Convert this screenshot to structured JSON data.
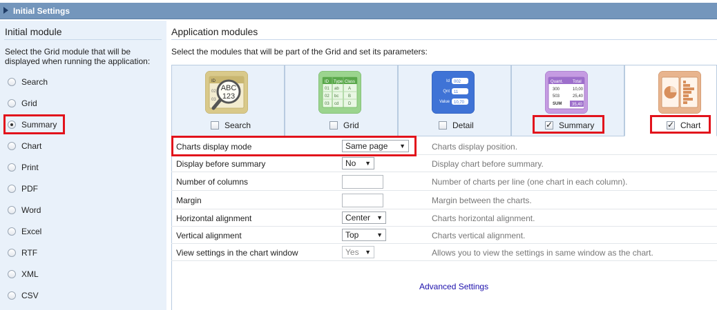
{
  "header": {
    "title": "Initial Settings"
  },
  "initial_module": {
    "title": "Initial module",
    "description": "Select the Grid module that will be displayed when running the application:",
    "options": [
      {
        "label": "Search",
        "checked": false
      },
      {
        "label": "Grid",
        "checked": false
      },
      {
        "label": "Summary",
        "checked": true
      },
      {
        "label": "Chart",
        "checked": false
      },
      {
        "label": "Print",
        "checked": false
      },
      {
        "label": "PDF",
        "checked": false
      },
      {
        "label": "Word",
        "checked": false
      },
      {
        "label": "Excel",
        "checked": false
      },
      {
        "label": "RTF",
        "checked": false
      },
      {
        "label": "XML",
        "checked": false
      },
      {
        "label": "CSV",
        "checked": false
      }
    ]
  },
  "application_modules": {
    "title": "Application modules",
    "description": "Select the modules that will be part of the Grid and set its parameters:",
    "modules": [
      {
        "label": "Search",
        "checked": false,
        "icon": "search-module-icon",
        "icon_text": [
          "ID",
          "02",
          "03",
          "ABC",
          "123"
        ]
      },
      {
        "label": "Grid",
        "checked": false,
        "icon": "grid-module-icon",
        "icon_text": [
          "ID",
          "Type",
          "Class",
          "01",
          "ab",
          "A",
          "02",
          "bc",
          "B",
          "03",
          "cd",
          "D"
        ]
      },
      {
        "label": "Detail",
        "checked": false,
        "icon": "detail-module-icon",
        "icon_text": [
          "Id",
          "002",
          "Qnt",
          "11",
          "Value",
          "10,70"
        ]
      },
      {
        "label": "Summary",
        "checked": true,
        "icon": "summary-module-icon",
        "icon_text": [
          "Quant.",
          "Total",
          "300",
          "10,00",
          "503",
          "25,40",
          "SUM",
          "35,40"
        ]
      },
      {
        "label": "Chart",
        "checked": true,
        "icon": "chart-module-icon"
      }
    ]
  },
  "chart_settings": [
    {
      "label": "Charts display mode",
      "control": "select",
      "value": "Same page",
      "help": "Charts display position."
    },
    {
      "label": "Display before summary",
      "control": "select",
      "value": "No",
      "help": "Display chart before summary."
    },
    {
      "label": "Number of columns",
      "control": "text",
      "value": "",
      "help": "Number of charts per line (one chart in each column)."
    },
    {
      "label": "Margin",
      "control": "text",
      "value": "",
      "help": "Margin between the charts."
    },
    {
      "label": "Horizontal alignment",
      "control": "select",
      "value": "Center",
      "help": "Charts horizontal alignment."
    },
    {
      "label": "Vertical alignment",
      "control": "select",
      "value": "Top",
      "help": "Charts vertical alignment."
    },
    {
      "label": "View settings in the chart window",
      "control": "select",
      "value": "Yes",
      "help": "Allows you to view the settings in same window as the chart.",
      "disabled": true
    }
  ],
  "advanced_link": "Advanced Settings",
  "colors": {
    "header_bar": "#7496bc",
    "left_panel": "#e9f1fa",
    "highlight": "#e2121b",
    "link": "#1a0dab"
  }
}
